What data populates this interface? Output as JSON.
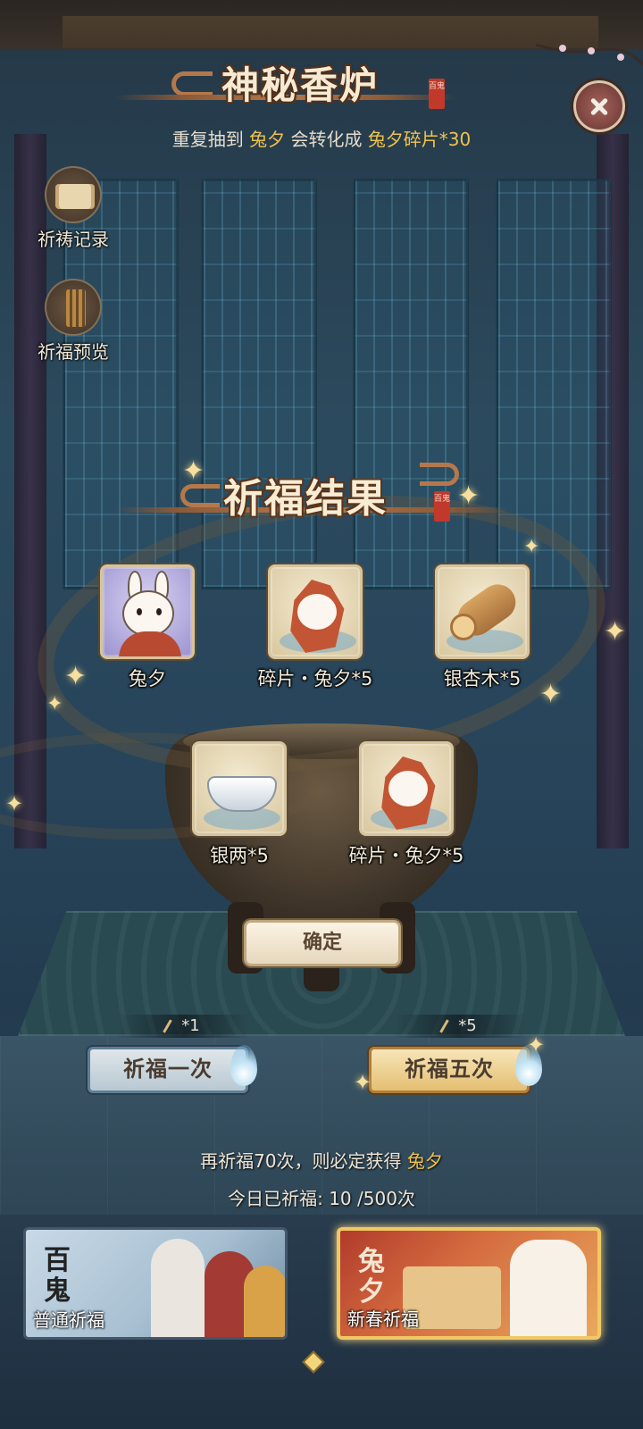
{
  "header": {
    "title": "神秘香炉",
    "seal_text": "百鬼",
    "duplicate_notice": {
      "prefix": "重复抽到",
      "character": "兔夕",
      "middle": "会转化成",
      "reward": "兔夕碎片*30"
    }
  },
  "side_menu": [
    {
      "label": "祈祷记录",
      "icon": "scroll-icon"
    },
    {
      "label": "祈福预览",
      "icon": "incense-icon"
    }
  ],
  "result_panel": {
    "title": "祈福结果",
    "seal_text": "百鬼",
    "items": [
      {
        "name": "兔夕",
        "icon": "rabbit-character-icon",
        "rarity": "purple"
      },
      {
        "name": "碎片・兔夕*5",
        "icon": "rabbit-fragment-icon",
        "rarity": "gold"
      },
      {
        "name": "银杏木*5",
        "icon": "ginkgo-wood-icon",
        "rarity": "gold"
      },
      {
        "name": "银两*5",
        "icon": "silver-ingot-icon",
        "rarity": "gold"
      },
      {
        "name": "碎片・兔夕*5",
        "icon": "rabbit-fragment-icon",
        "rarity": "gold"
      }
    ],
    "confirm_label": "确定"
  },
  "pray_buttons": [
    {
      "label": "祈福一次",
      "cost": "*1"
    },
    {
      "label": "祈福五次",
      "cost": "*5"
    }
  ],
  "pity": {
    "prefix": "再祈福70次，则必定获得",
    "character": "兔夕"
  },
  "today": {
    "label": "今日已祈福:",
    "count": "10",
    "limit": "/500次"
  },
  "banners": [
    {
      "label": "普通祈福",
      "logo": "百鬼",
      "selected": false
    },
    {
      "label": "新春祈福",
      "logo": "兔夕",
      "selected": true
    }
  ],
  "colors": {
    "highlight": "#f0c24b",
    "close_button": "#7e4540",
    "confirm_bg": "#fbf3e4"
  }
}
